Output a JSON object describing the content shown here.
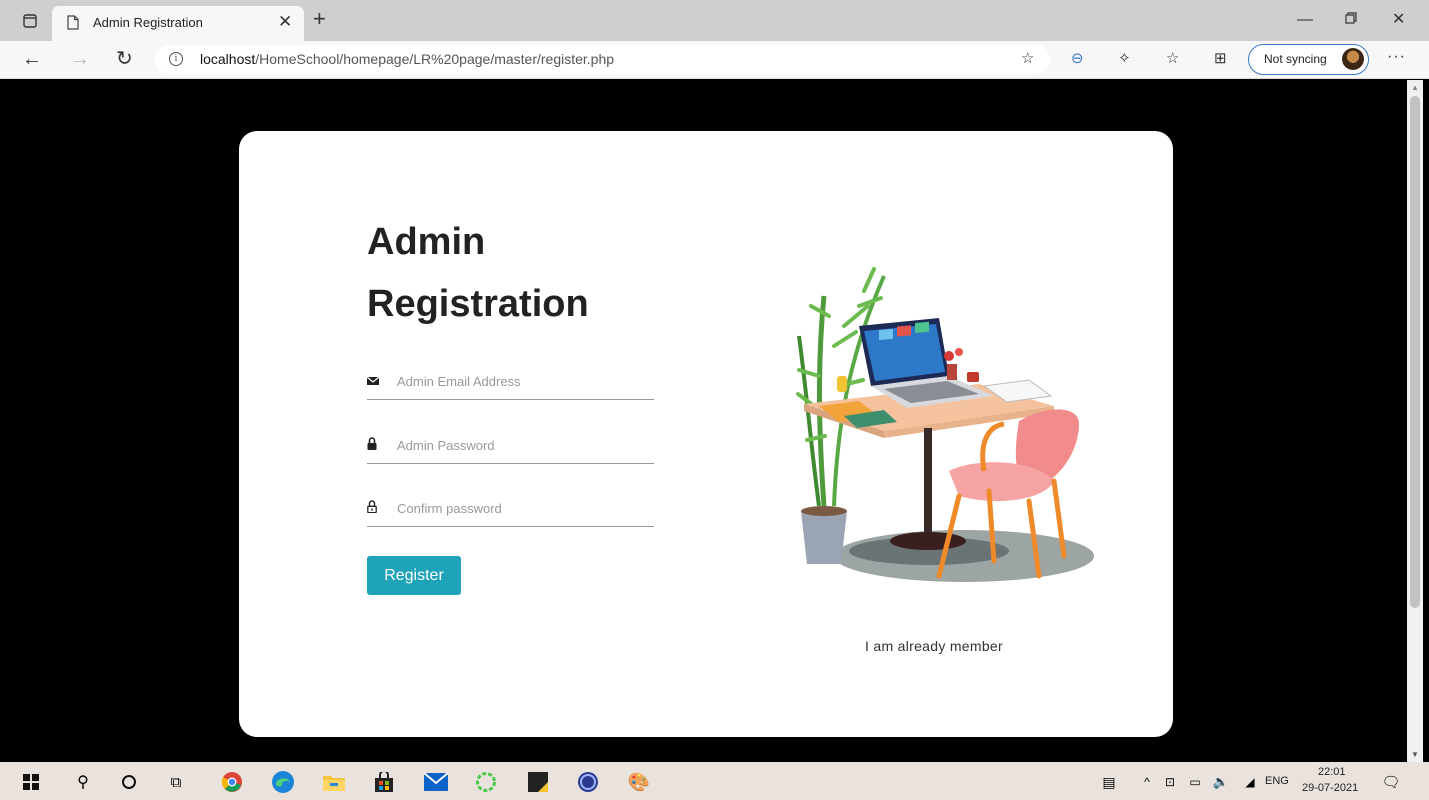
{
  "browser": {
    "tab_title": "Admin Registration",
    "url_host": "localhost",
    "url_path": "/HomeSchool/homepage/LR%20page/master/register.php",
    "sync_label": "Not syncing"
  },
  "page": {
    "heading_line1": "Admin",
    "heading_line2": "Registration",
    "email_placeholder": "Admin Email Address",
    "password_placeholder": "Admin Password",
    "confirm_placeholder": "Confirm password",
    "register_label": "Register",
    "member_link": "I am already member",
    "accent_color": "#1fa3b8"
  },
  "taskbar": {
    "language": "ENG",
    "time": "22:01",
    "date": "29-07-2021"
  }
}
